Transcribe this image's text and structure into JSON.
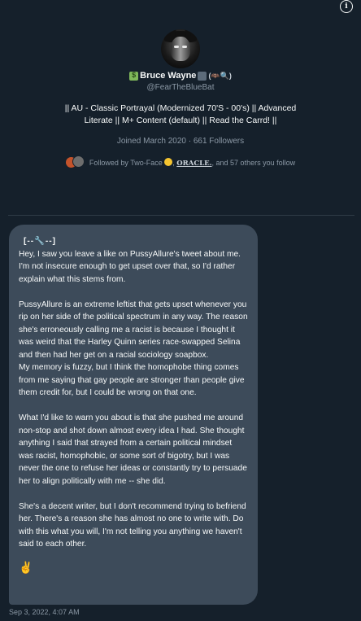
{
  "profile": {
    "display_name": "Bruce Wayne",
    "name_suffix": "(🦇🔍)",
    "handle": "@FearTheBlueBat",
    "bio": "|| AU - Classic Portrayal (Modernized 70'S - 00's) || Advanced Literate || M+ Content (default) || Read the Carrd! ||",
    "joined": "Joined March 2020 · 661 Followers",
    "followed_by_prefix": "Followed by Two-Face",
    "followed_by_oracle": "ORACLE.",
    "followed_by_suffix": ", and 57 others you follow"
  },
  "message": {
    "header": "[--🔧--]",
    "paragraphs": [
      "Hey, I saw you leave a like on PussyAllure's tweet about me. I'm not insecure enough to get upset over that, so I'd rather explain what this stems from.",
      "PussyAllure is an extreme leftist that gets upset whenever you rip on her side of the political spectrum in any way. The reason she's erroneously calling me a racist is because I thought it was weird that the Harley Quinn series race-swapped Selina and then had her get on a racial sociology soapbox.",
      "My memory is fuzzy, but I think the homophobe thing comes from me saying that gay people are stronger than people give them credit for, but I could be wrong on that one.",
      "What I'd like to warn you about is that she pushed me around non-stop and shot down almost every idea I had. She thought anything I said that strayed from a certain political mindset was racist, homophobic, or some sort of bigotry, but I was never the one to refuse her ideas or constantly try to persuade her to align politically with me -- she did.",
      "She's a decent writer, but I don't recommend trying to befriend her. There's a reason she has almost no one to write with. Do with this what you will, I'm not telling you anything we haven't said to each other."
    ],
    "signoff": "✌️",
    "timestamp": "Sep 3, 2022, 4:07 AM"
  },
  "icons": {
    "info": "info-icon",
    "avatar": "batman-avatar",
    "emoji_money": "money-emoji-icon",
    "emoji_bank": "bank-emoji-icon"
  },
  "colors": {
    "background": "#15202b",
    "bubble": "#3d4b5a",
    "muted": "#8b98a5"
  }
}
